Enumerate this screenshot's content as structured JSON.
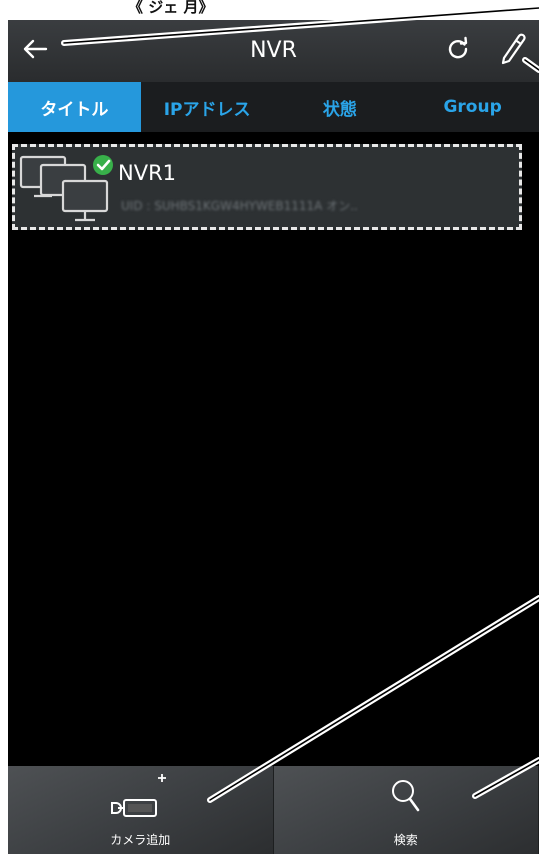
{
  "header": {
    "title": "NVR",
    "top_caption": "《 ジェ 月》"
  },
  "tabs": [
    {
      "label": "タイトル",
      "active": true
    },
    {
      "label": "IPアドレス",
      "active": false
    },
    {
      "label": "状態",
      "active": false
    },
    {
      "label": "Group",
      "active": false
    }
  ],
  "devices": [
    {
      "name": "NVR1",
      "detail": "UID : SUHBS1KGW4HYWEB1111A オン..",
      "status": "online"
    }
  ],
  "toolbar": {
    "add_camera_label": "カメラ追加",
    "search_label": "検索"
  },
  "colors": {
    "accent": "#2598dc",
    "tab_text": "#2aa4e8",
    "online_check": "#38b04a"
  },
  "icons": {
    "back": "back-arrow-icon",
    "refresh": "refresh-icon",
    "edit": "pencil-icon",
    "device": "nvr-monitor-icon",
    "add_camera": "add-camera-icon",
    "search": "search-icon"
  }
}
